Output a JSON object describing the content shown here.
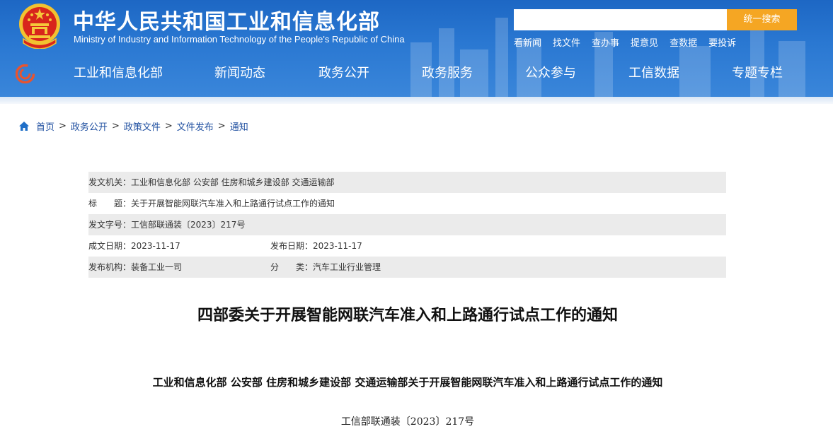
{
  "header": {
    "title": "中华人民共和国工业和信息化部",
    "subtitle": "Ministry of Industry and Information Technology of the People's Republic of China",
    "search": {
      "placeholder": "",
      "button_label": "统一搜索"
    },
    "quick_links": [
      "看新闻",
      "找文件",
      "查办事",
      "提意见",
      "查数据",
      "要投诉"
    ],
    "nav": [
      "工业和信息化部",
      "新闻动态",
      "政务公开",
      "政务服务",
      "公众参与",
      "工信数据",
      "专题专栏"
    ]
  },
  "breadcrumb": [
    "首页",
    "政务公开",
    "政策文件",
    "文件发布",
    "通知"
  ],
  "breadcrumb_separator": ">",
  "meta": {
    "issuer": "发文机关：工业和信息化部 公安部 住房和城乡建设部 交通运输部",
    "title": "标　　题：关于开展智能网联汽车准入和上路通行试点工作的通知",
    "doc_number": "发文字号：工信部联通装〔2023〕217号",
    "written_date": "成文日期：2023-11-17",
    "publish_date": "发布日期：2023-11-17",
    "publisher": "发布机构：装备工业一司",
    "category": "分　　类：汽车工业行业管理"
  },
  "article": {
    "title": "四部委关于开展智能网联汽车准入和上路通行试点工作的通知",
    "subtitle": "工业和信息化部 公安部 住房和城乡建设部 交通运输部关于开展智能网联汽车准入和上路通行试点工作的通知",
    "doc_number": "工信部联通装〔2023〕217号"
  },
  "colors": {
    "header_blue": "#2a78d2",
    "search_button": "#f5a623",
    "link_blue": "#1f4fa0",
    "meta_shade": "#ebebeb"
  },
  "icons": {
    "emblem": "national-emblem-icon",
    "nav_logo": "miit-logo-icon",
    "home": "home-icon"
  }
}
